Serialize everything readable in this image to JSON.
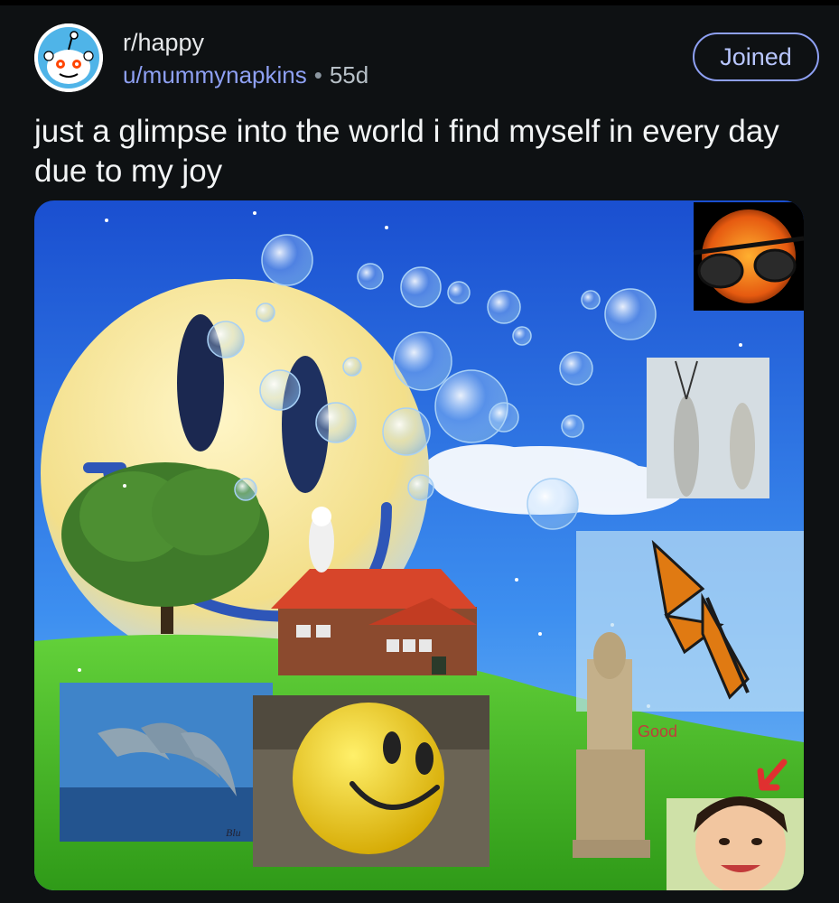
{
  "post": {
    "subreddit": "r/happy",
    "username": "u/mummynapkins",
    "separator": "•",
    "age": "55d",
    "join_label": "Joined",
    "title": "just a glimpse into the world i find myself in every day due to my joy"
  },
  "image": {
    "caption_good": "Good",
    "dolphin_tag": "Blu",
    "icons": [
      "reddit-snoo-avatar",
      "smiley-face",
      "sun-with-sunglasses",
      "butterfly",
      "dolphins",
      "smiley-ball",
      "statue",
      "child-face",
      "house",
      "tree",
      "bubbles"
    ]
  },
  "colors": {
    "background": "#0e1113",
    "accent": "#8ea0f3",
    "sky": "#2f6fe0",
    "grass": "#4fbf2a"
  }
}
